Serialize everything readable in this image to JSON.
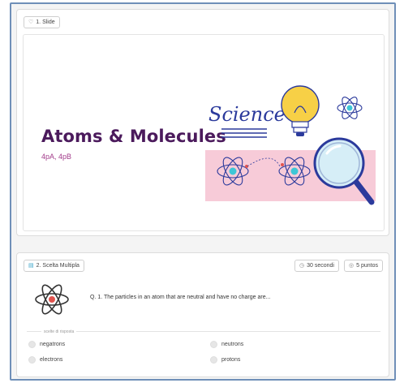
{
  "slide_card": {
    "tag_label": "1. Slide",
    "tag_icon": "heart-icon",
    "title": "Atoms & Molecules",
    "subtitle": "4pA, 4pB",
    "art_word": "Science"
  },
  "quiz_card": {
    "tag_label": "2. Scelta Multipla",
    "tag_icon": "list-icon",
    "time_label": "30 secondi",
    "points_label": "5 puntos",
    "question": "Q. 1. The particles in an atom that are neutral and have no charge are...",
    "options_heading": "scelte di risposta",
    "options": [
      "negatrons",
      "neutrons",
      "electrons",
      "protons"
    ]
  },
  "colors": {
    "title": "#4b1a5c",
    "subtitle": "#a23b8a",
    "frame_border": "#6f8fb8",
    "art_band": "#f7cbd8",
    "art_blue": "#2b3a9c",
    "bulb": "#f7d046"
  }
}
